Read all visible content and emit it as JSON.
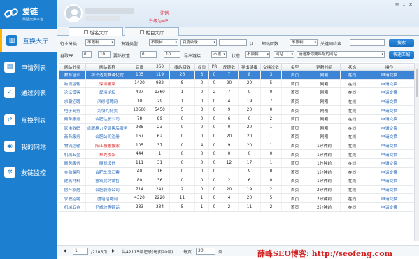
{
  "app": {
    "name": "爱链",
    "subtitle": "最强交换平台"
  },
  "header": {
    "logout": "注销",
    "upgrade": "升级为VIP"
  },
  "sidebar": {
    "items": [
      {
        "label": "互换大厅",
        "icon": "hall-icon"
      },
      {
        "label": "申请列表",
        "icon": "list-icon"
      },
      {
        "label": "通过列表",
        "icon": "check-icon"
      },
      {
        "label": "互换列表",
        "icon": "exchange-icon"
      },
      {
        "label": "我的网站",
        "icon": "site-icon"
      },
      {
        "label": "友链监控",
        "icon": "monitor-icon"
      }
    ]
  },
  "tabs": [
    {
      "label": "城名大厅"
    },
    {
      "label": "栏目大厅"
    }
  ],
  "filters": {
    "industry_label": "行业分类：",
    "industry_value": "不限制",
    "type_label": "友链类型：",
    "type_value": "不限制",
    "index_value": "百度收录",
    "index_above": "以上",
    "linkcount_label": "邮站回数：",
    "linkcount_value": "不限制",
    "keyword_label": "关键词检索：",
    "search_button": "搜索",
    "pr_label": "谷歌PR：",
    "pr_from": "0",
    "pr_to": "10",
    "weight_label": "要站权重：",
    "weight_from": "0",
    "weight_to": "10",
    "outlink_label": "导出链接：",
    "outlink_value": "不限",
    "status_label": "状态：",
    "status_value": "不限制",
    "site_value": "网站",
    "match_placeholder": "请选择你要匹配的网站",
    "match_button": "快速匹配"
  },
  "table": {
    "headers": [
      "网站分类",
      "网站名称",
      "百度",
      "360",
      "搜站回数",
      "权重",
      "PR",
      "反链数",
      "导出链接",
      "交换次数",
      "类型",
      "更新时间",
      "状态",
      "操作"
    ],
    "rows": [
      [
        "教育培训",
        "桥子达竞赛讲化院",
        "105",
        "119",
        "26",
        "3",
        "0",
        "7",
        "8",
        "3",
        "首页",
        "刚刚",
        "在线",
        "申请交换"
      ],
      [
        "物流运输",
        "深圳搬家",
        "1430",
        "932",
        "8",
        "0",
        "0",
        "20",
        "20",
        "5",
        "首页",
        "刚刚",
        "在线",
        "申请交换"
      ],
      [
        "论坛博客",
        "焊接论坛",
        "427",
        "1360",
        "1",
        "0",
        "2",
        "7",
        "0",
        "0",
        "首页",
        "刚刚",
        "在线",
        "申请交换"
      ],
      [
        "求职招聘",
        "汽修招聘网",
        "10",
        "29",
        "1",
        "0",
        "0",
        "4",
        "19",
        "7",
        "首页",
        "刚刚",
        "在线",
        "申请交换"
      ],
      [
        "电子商务",
        "九块九特卖",
        "10500",
        "5450",
        "5",
        "3",
        "0",
        "9",
        "20",
        "0",
        "首页",
        "刚刚",
        "在线",
        "申请交换"
      ],
      [
        "商务服务",
        "合肥注册公司",
        "78",
        "89",
        "0",
        "0",
        "0",
        "6",
        "0",
        "2",
        "首页",
        "刚刚",
        "在线",
        "申请交换"
      ],
      [
        "家电数码",
        "合肥格力空调售后服务",
        "985",
        "23",
        "0",
        "0",
        "0",
        "0",
        "20",
        "1",
        "首页",
        "刚刚",
        "在线",
        "申请交换"
      ],
      [
        "商务服务",
        "合肥公司注册",
        "167",
        "62",
        "0",
        "0",
        "0",
        "20",
        "20",
        "1",
        "首页",
        "刚刚",
        "在线",
        "申请交换"
      ],
      [
        "物流运输",
        "阳江搬搬搬家",
        "105",
        "37",
        "0",
        "4",
        "0",
        "9",
        "20",
        "1",
        "首页",
        "1分钟前",
        "在线",
        "申请交换"
      ],
      [
        "机械五金",
        "东莞模架",
        "444",
        "1",
        "0",
        "0",
        "0",
        "0",
        "0",
        "0",
        "首页",
        "1分钟前",
        "在线",
        "申请交换"
      ],
      [
        "商务服务",
        "商标设计",
        "111",
        "31",
        "0",
        "0",
        "0",
        "12",
        "17",
        "1",
        "首页",
        "1分钟前",
        "在线",
        "申请交换"
      ],
      [
        "金融保险",
        "合肥车贷汇票",
        "40",
        "16",
        "0",
        "0",
        "0",
        "1",
        "9",
        "0",
        "首页",
        "1分钟前",
        "在线",
        "申请交换"
      ],
      [
        "建筑材料",
        "氢氧化钙销售",
        "80",
        "36",
        "0",
        "0",
        "0",
        "2",
        "6",
        "0",
        "首页",
        "1分钟前",
        "在线",
        "申请交换"
      ],
      [
        "房产家居",
        "合肥装修公司",
        "714",
        "241",
        "2",
        "0",
        "0",
        "20",
        "19",
        "2",
        "首页",
        "2分钟前",
        "在线",
        "申请交换"
      ],
      [
        "求职招聘",
        "厦培招聘网",
        "4320",
        "2220",
        "11",
        "1",
        "0",
        "4",
        "20",
        "5",
        "首页",
        "2分钟前",
        "在线",
        "申请交换"
      ],
      [
        "机械五金",
        "亿威绞盘链话",
        "233",
        "234",
        "5",
        "1",
        "0",
        "2",
        "11",
        "2",
        "首页",
        "2分钟前",
        "在线",
        "申请交换"
      ]
    ],
    "red_rows": [
      1,
      8,
      9
    ]
  },
  "pager": {
    "page": "1",
    "total_pages": "/2106页",
    "summary": "共42115条记录(每页20条)",
    "per_label": "每页",
    "per_value": "20",
    "per_unit": "条"
  },
  "watermark": "薛峰SEO博客: http://seofeng.com",
  "colors": {
    "sidebar": "#1c7fd0",
    "selected_row": "#3c84d6",
    "link": "#2a6ab8",
    "red": "#d52020"
  }
}
